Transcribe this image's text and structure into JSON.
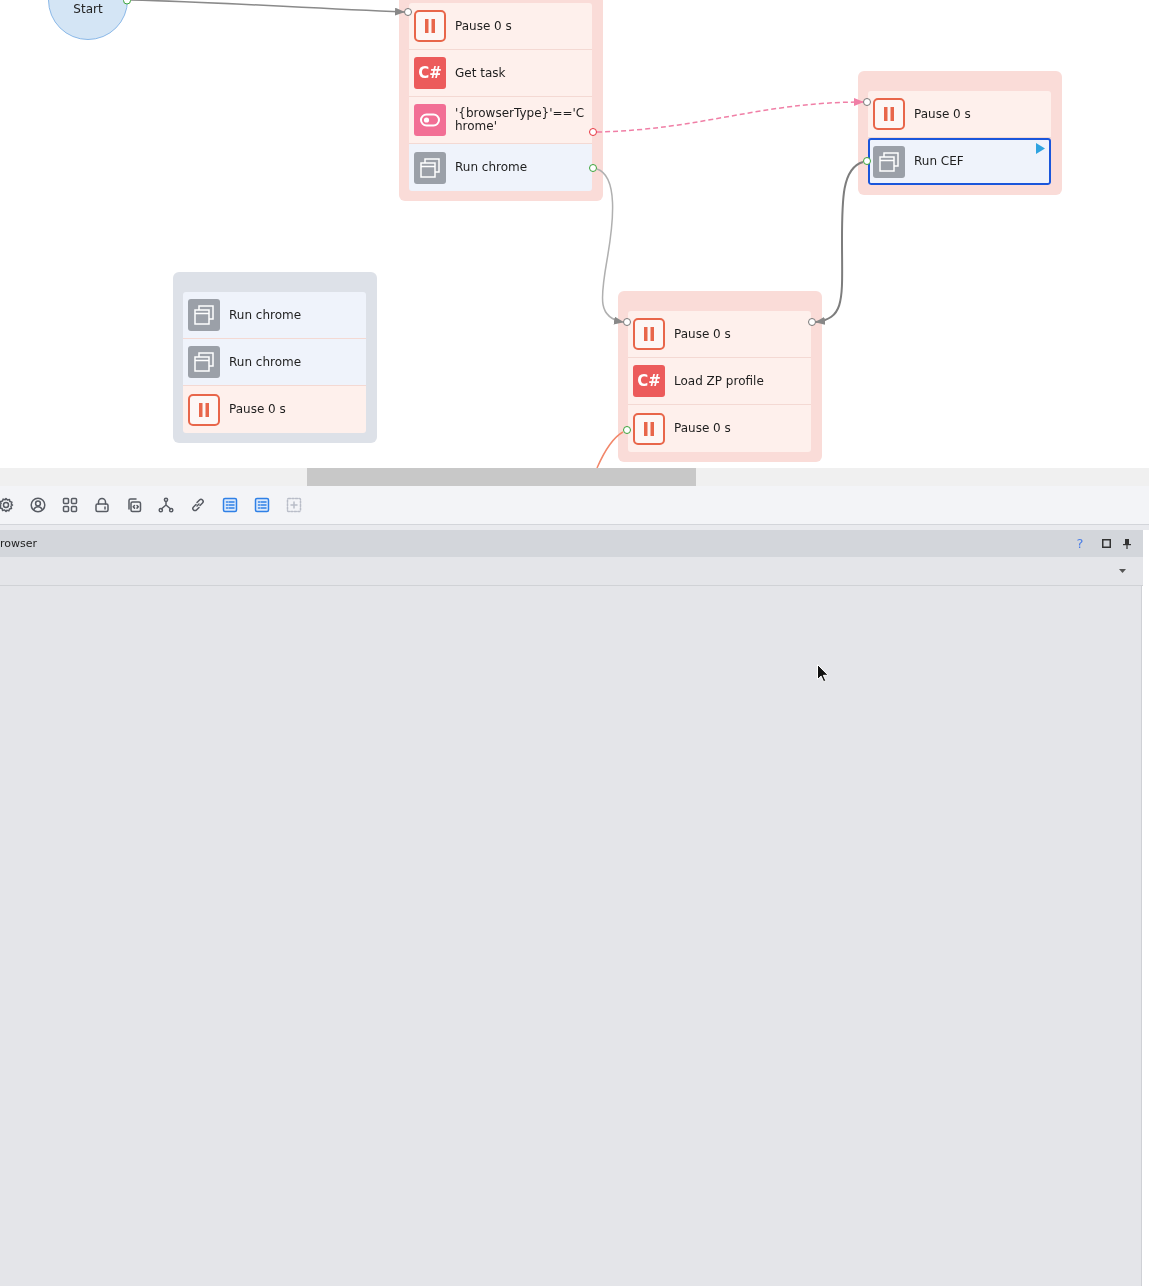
{
  "canvas": {
    "start_node": {
      "label": "Start"
    },
    "groups": [
      {
        "color": "#fadcd8",
        "items": [
          {
            "kind": "pause",
            "label": "Pause 0 s",
            "selected": false
          },
          {
            "kind": "csharp",
            "badge": "C#",
            "label": "Get task",
            "selected": false
          },
          {
            "kind": "condition",
            "label": "'{browserType}'=='Chrome'",
            "selected": false
          },
          {
            "kind": "browser",
            "label": "Run chrome",
            "selected": false
          }
        ]
      },
      {
        "color": "#fadcd8",
        "items": [
          {
            "kind": "pause",
            "label": "Pause 0 s",
            "selected": false
          },
          {
            "kind": "browser",
            "label": "Run CEF",
            "selected": true
          }
        ]
      },
      {
        "color": "#dde1e8",
        "items": [
          {
            "kind": "browser",
            "label": "Run chrome",
            "selected": false
          },
          {
            "kind": "browser",
            "label": "Run chrome",
            "selected": false
          },
          {
            "kind": "pause",
            "label": "Pause 0 s",
            "selected": false
          }
        ]
      },
      {
        "color": "#fadcd8",
        "items": [
          {
            "kind": "pause",
            "label": "Pause 0 s",
            "selected": false
          },
          {
            "kind": "csharp",
            "badge": "C#",
            "label": "Load ZP profile",
            "selected": false
          },
          {
            "kind": "pause",
            "label": "Pause 0 s",
            "selected": false
          }
        ]
      }
    ]
  },
  "toolbar": {
    "buttons": [
      {
        "kind": "settings",
        "on": false,
        "disabled": false
      },
      {
        "kind": "user",
        "on": false,
        "disabled": false
      },
      {
        "kind": "grid",
        "on": false,
        "disabled": false
      },
      {
        "kind": "lock",
        "on": false,
        "disabled": false
      },
      {
        "kind": "script",
        "on": false,
        "disabled": false
      },
      {
        "kind": "branch",
        "on": false,
        "disabled": false
      },
      {
        "kind": "link",
        "on": false,
        "disabled": false
      },
      {
        "kind": "list",
        "on": true,
        "disabled": false
      },
      {
        "kind": "list",
        "on": true,
        "disabled": false
      },
      {
        "kind": "add",
        "on": false,
        "disabled": true
      }
    ]
  },
  "panel": {
    "title": "rowser",
    "help": "?"
  }
}
